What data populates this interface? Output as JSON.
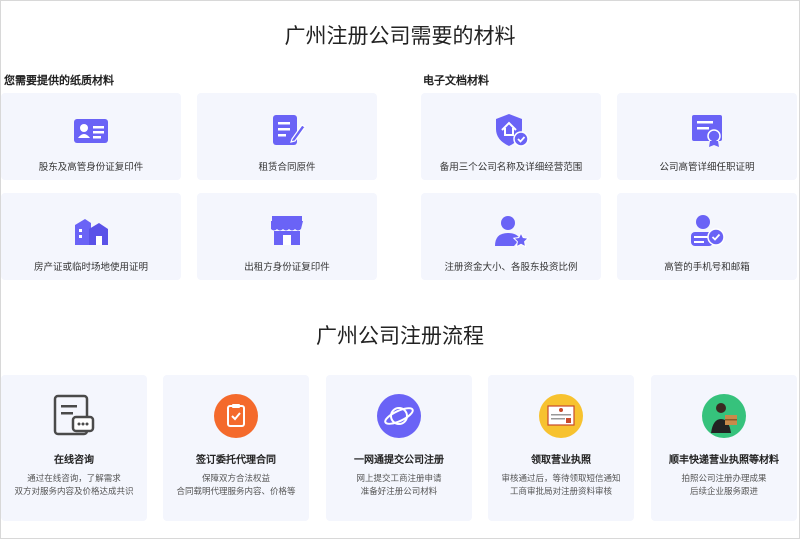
{
  "titles": {
    "materials": "广州注册公司需要的材料",
    "process": "广州公司注册流程"
  },
  "sections": {
    "paper": "您需要提供的纸质材料",
    "electronic": "电子文档材料"
  },
  "paper_items": [
    {
      "label": "股东及高管身份证复印件",
      "icon": "id-card-icon"
    },
    {
      "label": "租赁合同原件",
      "icon": "contract-edit-icon"
    },
    {
      "label": "房产证或临时场地使用证明",
      "icon": "building-icon"
    },
    {
      "label": "出租方身份证复印件",
      "icon": "storefront-icon"
    }
  ],
  "electronic_items": [
    {
      "label": "备用三个公司名称及详细经营范围",
      "icon": "shield-check-icon"
    },
    {
      "label": "公司高管详细任职证明",
      "icon": "certificate-icon"
    },
    {
      "label": "注册资金大小、各股东投资比例",
      "icon": "user-star-icon"
    },
    {
      "label": "高管的手机号和邮箱",
      "icon": "user-verified-icon"
    }
  ],
  "steps": [
    {
      "title": "在线咨询",
      "desc1": "通过在线咨询，了解需求",
      "desc2": "双方对服务内容及价格达成共识",
      "icon": "chat-document-icon"
    },
    {
      "title": "签订委托代理合同",
      "desc1": "保障双方合法权益",
      "desc2": "合同载明代理服务内容、价格等",
      "icon": "clipboard-check-icon"
    },
    {
      "title": "一网通提交公司注册",
      "desc1": "网上提交工商注册申请",
      "desc2": "准备好注册公司材料",
      "icon": "planet-icon"
    },
    {
      "title": "领取营业执照",
      "desc1": "审核通过后，等待领取短信通知",
      "desc2": "工商审批局对注册资料审核",
      "icon": "business-license-icon"
    },
    {
      "title": "顺丰快递营业执照等材料",
      "desc1": "拍照公司注册办理成果",
      "desc2": "后续企业服务跟进",
      "icon": "courier-icon"
    }
  ],
  "colors": {
    "accent": "#6a63f6",
    "card_bg": "#f4f6fd",
    "orange": "#f46a2c",
    "gold": "#f7c22f",
    "green": "#36c27c"
  }
}
